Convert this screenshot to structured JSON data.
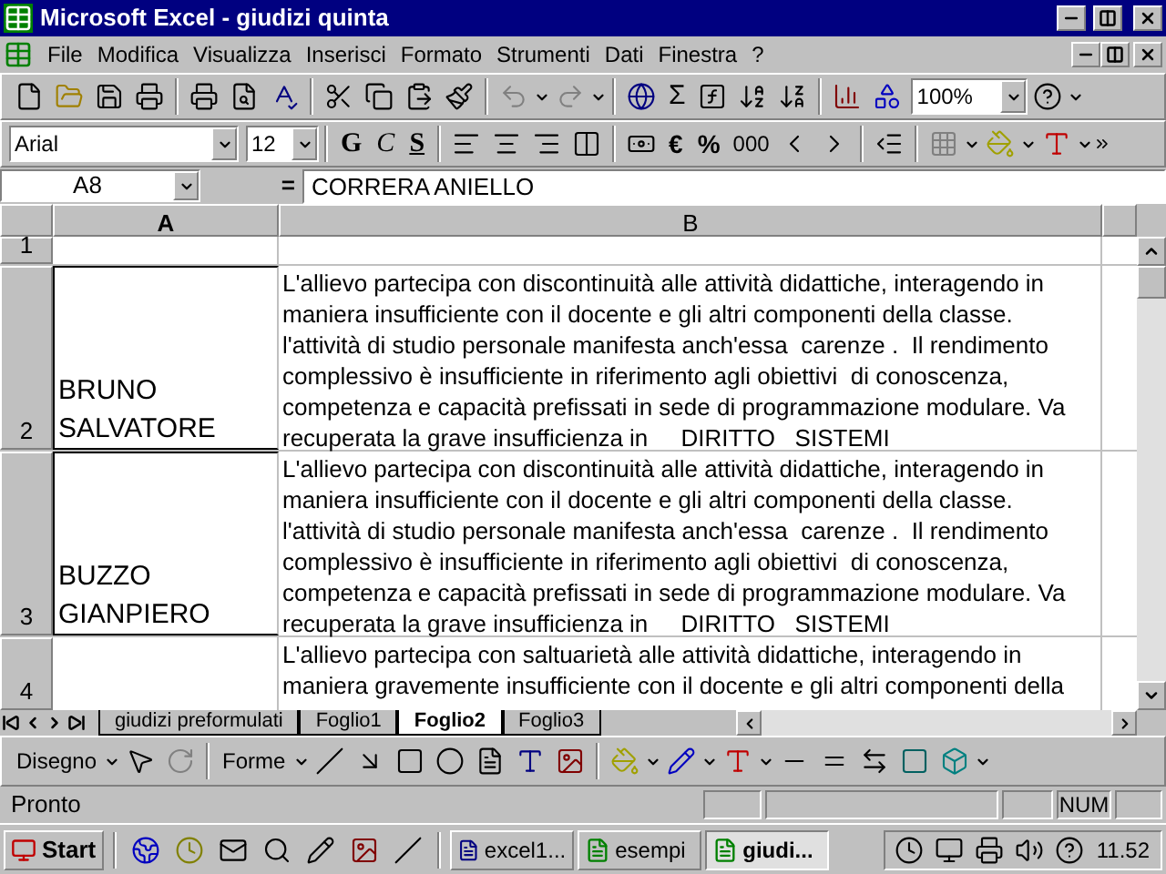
{
  "window": {
    "title": "Microsoft Excel - giudizi quinta"
  },
  "menu": [
    "File",
    "Modifica",
    "Visualizza",
    "Inserisci",
    "Formato",
    "Strumenti",
    "Dati",
    "Finestra",
    "?"
  ],
  "standard_toolbar": {
    "sum": "Σ",
    "zoom": "100%"
  },
  "format_toolbar": {
    "font": "Arial",
    "size": "12",
    "bold": "G",
    "italic": "C",
    "underline": "S",
    "euro": "€",
    "percent": "%",
    "thousands": "000"
  },
  "formula_bar": {
    "name_box": "A8",
    "equals": "=",
    "value": "CORRERA ANIELLO"
  },
  "sheet": {
    "columns": [
      "A",
      "B"
    ],
    "rows": [
      {
        "header": "1"
      },
      {
        "header": "2",
        "name": "BRUNO\nSALVATORE",
        "text": "L'allievo partecipa con discontinuità alle attività didattiche, interagendo in maniera insufficiente con il docente e gli altri componenti della classe. l'attività di studio personale manifesta anch'essa  carenze .  Il rendimento complessivo è insufficiente in riferimento agli obiettivi  di conoscenza, competenza e capacità prefissati in sede di programmazione modulare. Va recuperata la grave insufficienza in     DIRITTO   SISTEMI"
      },
      {
        "header": "3",
        "name": "BUZZO\nGIANPIERO",
        "text": "L'allievo partecipa con discontinuità alle attività didattiche, interagendo in maniera insufficiente con il docente e gli altri componenti della classe. l'attività di studio personale manifesta anch'essa  carenze .  Il rendimento complessivo è insufficiente in riferimento agli obiettivi  di conoscenza, competenza e capacità prefissati in sede di programmazione modulare. Va recuperata la grave insufficienza in     DIRITTO   SISTEMI"
      },
      {
        "header": "4",
        "text": "L'allievo partecipa con saltuarietà alle attività didattiche, interagendo in maniera gravemente insufficiente con il docente e gli altri componenti della"
      }
    ]
  },
  "sheet_tabs": [
    {
      "label": "giudizi preformulati",
      "selected": false
    },
    {
      "label": "Foglio1",
      "selected": false
    },
    {
      "label": "Foglio2",
      "selected": true
    },
    {
      "label": "Foglio3",
      "selected": false
    }
  ],
  "drawing_toolbar": {
    "draw_menu": "Disegno",
    "shapes_menu": "Forme"
  },
  "status_bar": {
    "status": "Pronto",
    "num": "NUM"
  },
  "taskbar": {
    "start": "Start",
    "tasks": [
      {
        "label": "excel1...",
        "selected": false
      },
      {
        "label": "esempi",
        "selected": false
      },
      {
        "label": "giudi...",
        "selected": true
      }
    ],
    "clock": "11.52"
  }
}
